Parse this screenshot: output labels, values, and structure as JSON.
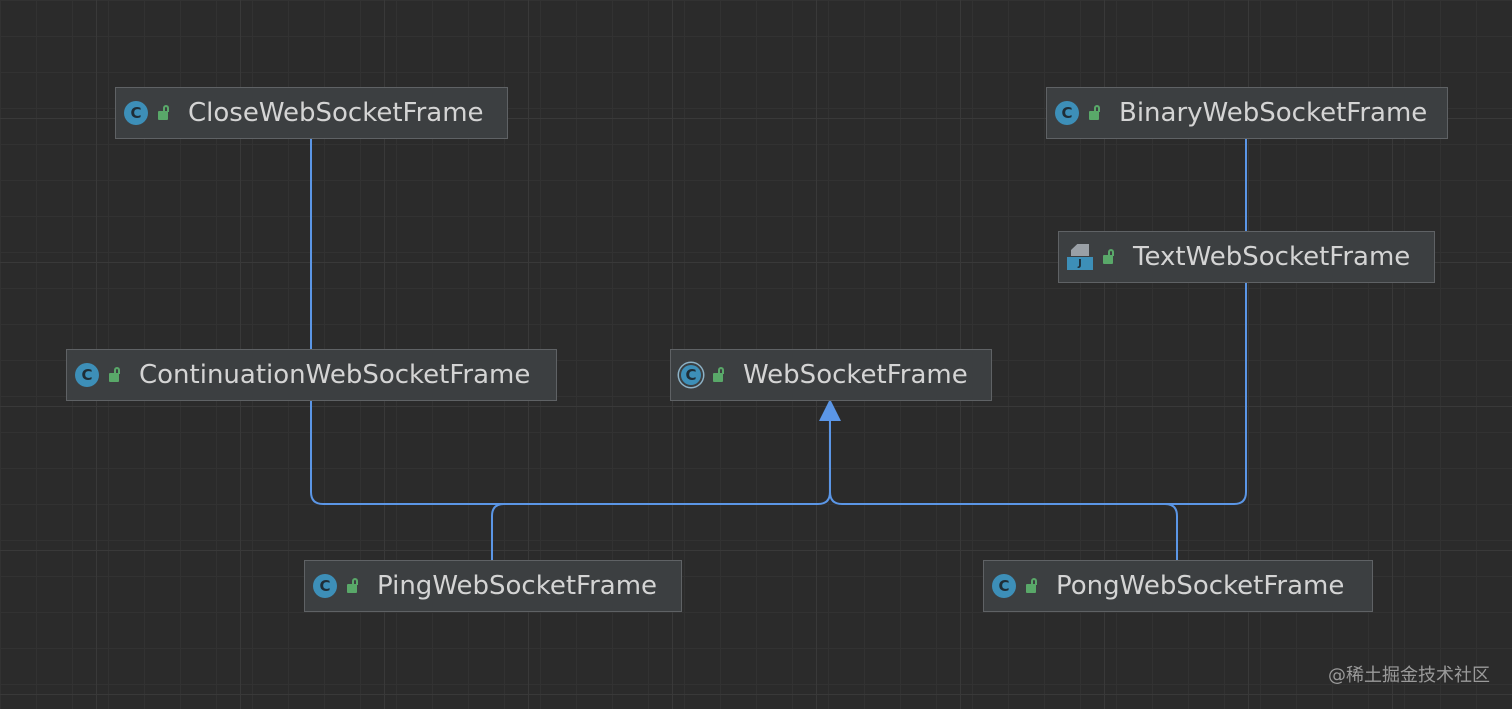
{
  "nodes": {
    "close": {
      "label": "CloseWebSocketFrame",
      "icon": "class-icon"
    },
    "binary": {
      "label": "BinaryWebSocketFrame",
      "icon": "class-icon"
    },
    "text": {
      "label": "TextWebSocketFrame",
      "icon": "java-file-icon"
    },
    "continuation": {
      "label": "ContinuationWebSocketFrame",
      "icon": "class-icon"
    },
    "websocket": {
      "label": "WebSocketFrame",
      "icon": "abstract-class-icon"
    },
    "ping": {
      "label": "PingWebSocketFrame",
      "icon": "class-icon"
    },
    "pong": {
      "label": "PongWebSocketFrame",
      "icon": "class-icon"
    }
  },
  "icon_glyphs": {
    "class": "C",
    "java_file": "J"
  },
  "colors": {
    "background": "#2b2b2b",
    "edge": "#5b96e6",
    "class_icon": "#3d8fb8",
    "lock": "#59a869",
    "node_fill": "#3c3f41"
  },
  "watermark": "@稀土掘金技术社区"
}
